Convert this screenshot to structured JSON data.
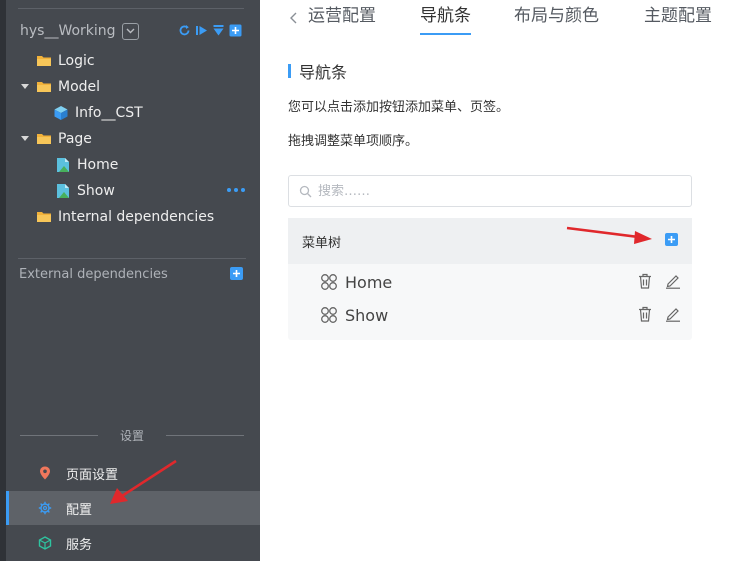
{
  "sidebar": {
    "project_name": "hys__Working",
    "tree": [
      {
        "label": "Logic",
        "type": "folder"
      },
      {
        "label": "Model",
        "type": "folder"
      },
      {
        "label": "Info__CST",
        "type": "model"
      },
      {
        "label": "Page",
        "type": "folder"
      },
      {
        "label": "Home",
        "type": "page"
      },
      {
        "label": "Show",
        "type": "page"
      },
      {
        "label": "Internal dependencies",
        "type": "folder"
      }
    ],
    "external_label": "External dependencies",
    "settings_label": "设置",
    "nav": [
      {
        "label": "页面设置",
        "icon": "location-pin-icon"
      },
      {
        "label": "配置",
        "icon": "gear-icon"
      },
      {
        "label": "服务",
        "icon": "cube-icon"
      }
    ]
  },
  "main": {
    "tabs": [
      {
        "label": "运营配置"
      },
      {
        "label": "导航条"
      },
      {
        "label": "布局与颜色"
      },
      {
        "label": "主题配置"
      }
    ],
    "section_title": "导航条",
    "desc1": "您可以点击添加按钮添加菜单、页签。",
    "desc2": "拖拽调整菜单项顺序。",
    "search": {
      "placeholder": "搜索……",
      "value": ""
    },
    "menu_tree_title": "菜单树",
    "menu_items": [
      {
        "label": "Home"
      },
      {
        "label": "Show"
      }
    ]
  },
  "colors": {
    "accent": "#3b9cf5",
    "sidebar_bg": "#45494f",
    "annotation_arrow": "#e0282c",
    "folder": "#f2b23a",
    "page": "#5bc0de"
  }
}
